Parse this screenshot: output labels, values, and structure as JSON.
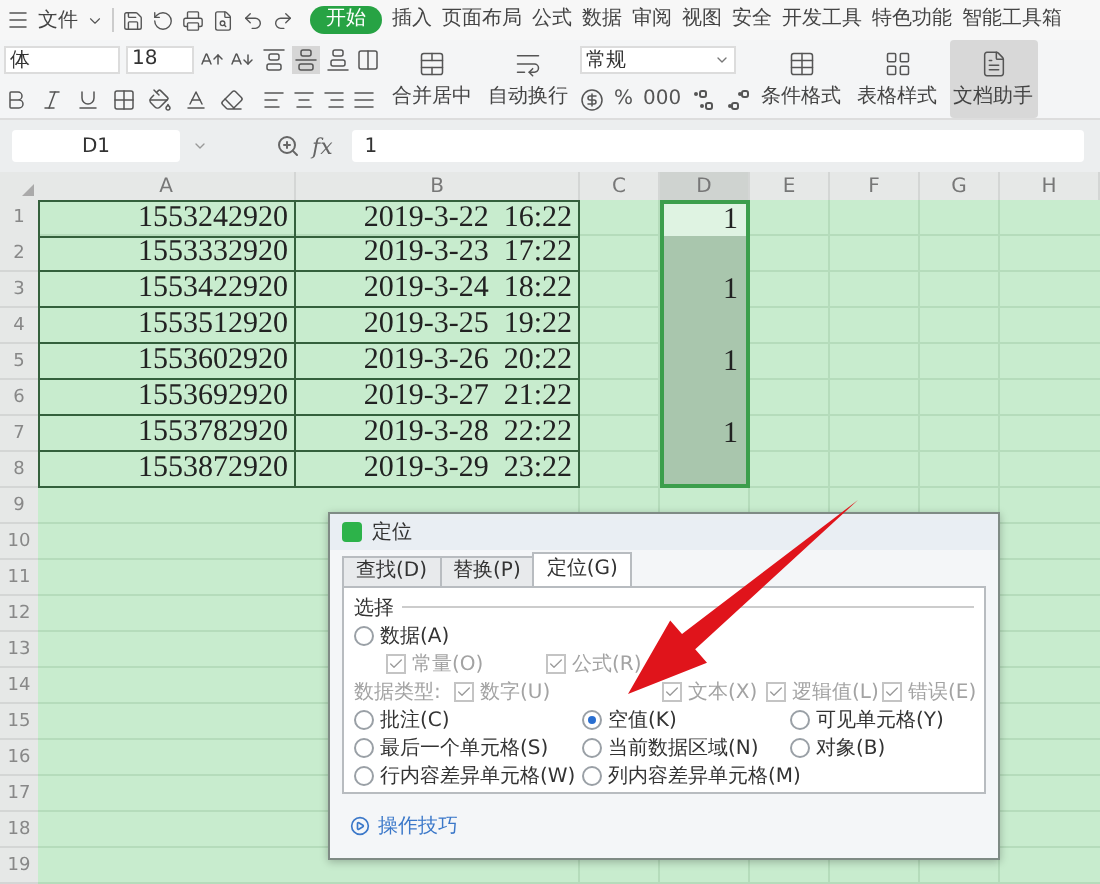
{
  "menu": {
    "file": "文件",
    "tabs": [
      {
        "label": "开始",
        "selected": true
      },
      {
        "label": "插入",
        "selected": false
      },
      {
        "label": "页面布局",
        "selected": false
      },
      {
        "label": "公式",
        "selected": false
      },
      {
        "label": "数据",
        "selected": false
      },
      {
        "label": "审阅",
        "selected": false
      },
      {
        "label": "视图",
        "selected": false
      },
      {
        "label": "安全",
        "selected": false
      },
      {
        "label": "开发工具",
        "selected": false
      },
      {
        "label": "特色功能",
        "selected": false
      },
      {
        "label": "智能工具箱",
        "selected": false
      }
    ]
  },
  "ribbon": {
    "font": "体",
    "font_size": "18",
    "percent": "%",
    "thousands": "000",
    "merge": "合并居中",
    "wrap": "自动换行",
    "number_format": "常规",
    "conditional_format": "条件格式",
    "table_style": "表格样式",
    "assistant": "文档助手"
  },
  "formula_bar": {
    "cell_ref": "D1",
    "fx": "fx",
    "value": "1"
  },
  "sheet": {
    "columns": [
      {
        "label": "A",
        "selected": false
      },
      {
        "label": "B",
        "selected": false
      },
      {
        "label": "C",
        "selected": false
      },
      {
        "label": "D",
        "selected": true
      },
      {
        "label": "E",
        "selected": false
      },
      {
        "label": "F",
        "selected": false
      },
      {
        "label": "G",
        "selected": false
      },
      {
        "label": "H",
        "selected": false
      }
    ],
    "rows": [
      {
        "number": "1",
        "a": "1553242920",
        "b": "2019-3-22  16:22",
        "d": {
          "value": "1",
          "selected": true,
          "active": true
        }
      },
      {
        "number": "2",
        "a": "1553332920",
        "b": "2019-3-23  17:22",
        "d": {
          "selected": true,
          "active": false
        }
      },
      {
        "number": "3",
        "a": "1553422920",
        "b": "2019-3-24  18:22",
        "d": {
          "value": "1",
          "selected": true,
          "active": false
        }
      },
      {
        "number": "4",
        "a": "1553512920",
        "b": "2019-3-25  19:22",
        "d": {
          "selected": true,
          "active": false
        }
      },
      {
        "number": "5",
        "a": "1553602920",
        "b": "2019-3-26  20:22",
        "d": {
          "value": "1",
          "selected": true,
          "active": false
        }
      },
      {
        "number": "6",
        "a": "1553692920",
        "b": "2019-3-27  21:22",
        "d": {
          "selected": true,
          "active": false
        }
      },
      {
        "number": "7",
        "a": "1553782920",
        "b": "2019-3-28  22:22",
        "d": {
          "value": "1",
          "selected": true,
          "active": false
        }
      },
      {
        "number": "8",
        "a": "1553872920",
        "b": "2019-3-29  23:22",
        "d": {
          "selected": true,
          "active": false
        }
      }
    ],
    "empty_rows": [
      "9",
      "10",
      "11",
      "12",
      "13",
      "14",
      "15",
      "16",
      "17",
      "18",
      "19"
    ]
  },
  "dialog": {
    "title": "定位",
    "tabs": [
      {
        "label": "查找(D)",
        "selected": false
      },
      {
        "label": "替换(P)",
        "selected": false
      },
      {
        "label": "定位(G)",
        "selected": true
      }
    ],
    "group": "选择",
    "data_option": {
      "label": "数据(A)",
      "selected": false
    },
    "data_checks": [
      {
        "label": "常量(O)",
        "checked": true,
        "disabled": true
      },
      {
        "label": "公式(R)",
        "checked": true,
        "disabled": true
      }
    ],
    "data_type_label": "数据类型:",
    "data_types": [
      {
        "label": "数字(U)",
        "checked": true,
        "disabled": true
      },
      {
        "label": "文本(X)",
        "checked": true,
        "disabled": true
      },
      {
        "label": "逻辑值(L)",
        "checked": true,
        "disabled": true
      },
      {
        "label": "错误(E)",
        "checked": true,
        "disabled": true
      }
    ],
    "options": [
      {
        "label": "批注(C)",
        "selected": false
      },
      {
        "label": "空值(K)",
        "selected": true
      },
      {
        "label": "可见单元格(Y)",
        "selected": false
      },
      {
        "label": "最后一个单元格(S)",
        "selected": false
      },
      {
        "label": "当前数据区域(N)",
        "selected": false
      },
      {
        "label": "对象(B)",
        "selected": false
      },
      {
        "label": "行内容差异单元格(W)",
        "selected": false
      },
      {
        "label": "列内容差异单元格(M)",
        "selected": false
      }
    ],
    "tips": "操作技巧"
  }
}
